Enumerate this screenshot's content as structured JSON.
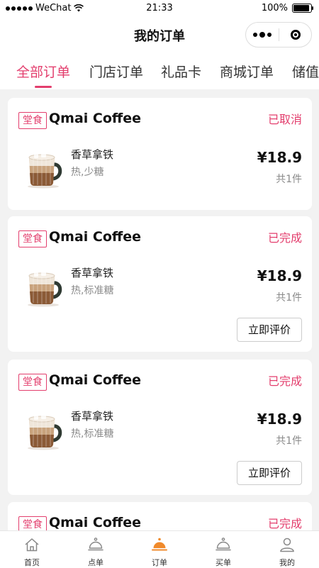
{
  "status_bar": {
    "carrier": "WeChat",
    "time": "21:33",
    "battery": "100%"
  },
  "nav": {
    "title": "我的订单"
  },
  "tabs": [
    {
      "label": "全部订单",
      "active": true
    },
    {
      "label": "门店订单",
      "active": false
    },
    {
      "label": "礼品卡",
      "active": false
    },
    {
      "label": "商城订单",
      "active": false
    },
    {
      "label": "储值",
      "active": false
    }
  ],
  "orders": [
    {
      "tag": "堂食",
      "store": "Qmai Coffee",
      "status": "已取消",
      "item": "香草拿铁",
      "spec": "热,少糖",
      "price": "¥18.9",
      "count": "共1件",
      "action": ""
    },
    {
      "tag": "堂食",
      "store": "Qmai Coffee",
      "status": "已完成",
      "item": "香草拿铁",
      "spec": "热,标准糖",
      "price": "¥18.9",
      "count": "共1件",
      "action": "立即评价"
    },
    {
      "tag": "堂食",
      "store": "Qmai Coffee",
      "status": "已完成",
      "item": "香草拿铁",
      "spec": "热,标准糖",
      "price": "¥18.9",
      "count": "共1件",
      "action": "立即评价"
    },
    {
      "tag": "堂食",
      "store": "Qmai Coffee",
      "status": "已完成"
    }
  ],
  "bottom_tabs": [
    {
      "label": "首页",
      "icon": "home-icon"
    },
    {
      "label": "点单",
      "icon": "cloche-icon"
    },
    {
      "label": "订单",
      "icon": "cloche-icon",
      "active": true
    },
    {
      "label": "买单",
      "icon": "cloche-icon"
    },
    {
      "label": "我的",
      "icon": "user-icon"
    }
  ],
  "colors": {
    "accent": "#e33e6d",
    "active_tab_icon": "#f08a2b"
  }
}
